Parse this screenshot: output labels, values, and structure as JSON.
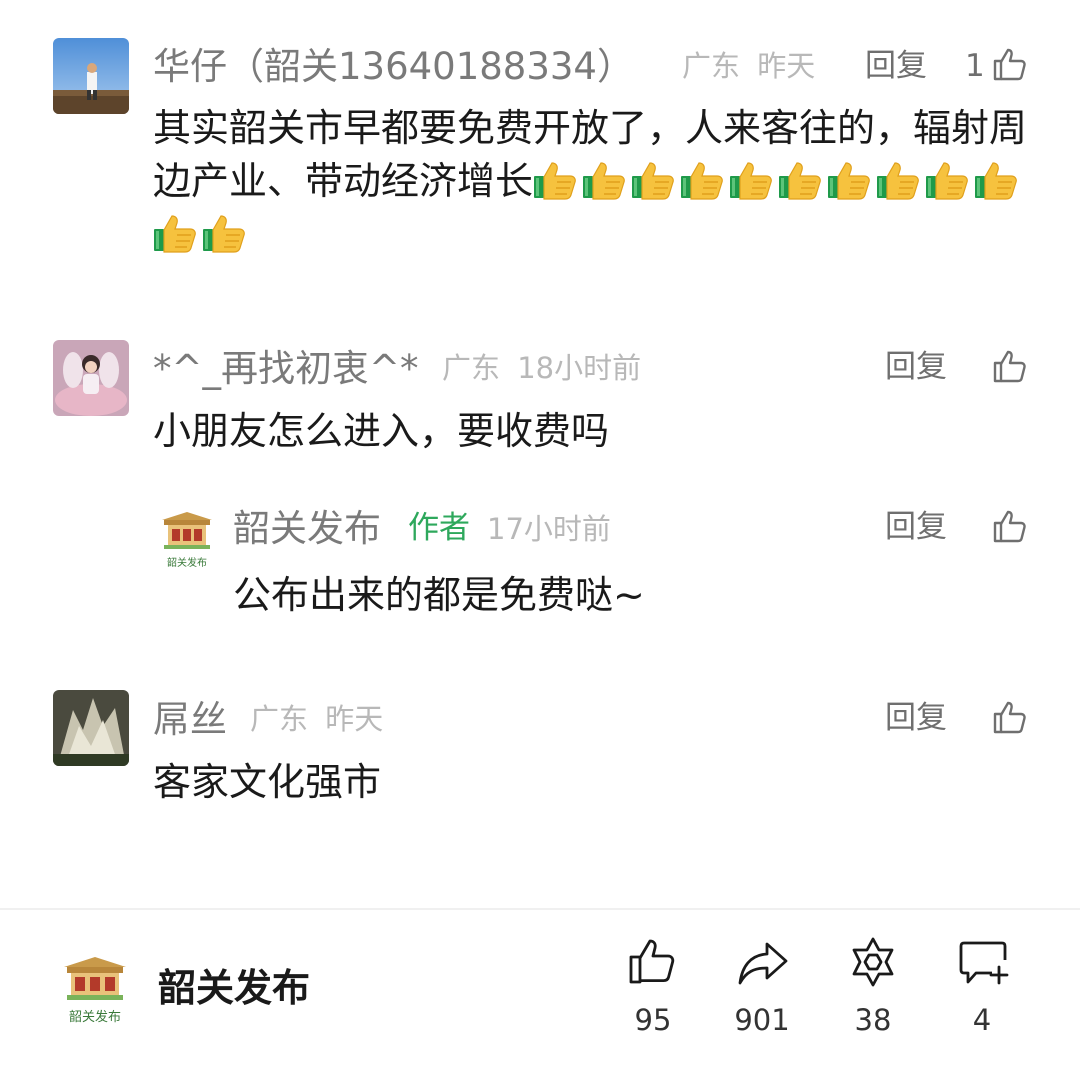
{
  "comments": [
    {
      "user": "华仔（韶关13640188334）",
      "location": "广东",
      "time": "昨天",
      "reply_label": "回复",
      "like_count": "1",
      "text": "其实韶关市早都要免费开放了，人来客往的，辐射周边产业、带动经济增长",
      "emoji_count": 12,
      "emoji": "thumbs-up-emoji"
    },
    {
      "user": "*^_再找初衷^*",
      "location": "广东",
      "time": "18小时前",
      "reply_label": "回复",
      "like_count": "",
      "text": "小朋友怎么进入，要收费吗",
      "replies": [
        {
          "user": "韶关发布",
          "badge": "作者",
          "time": "17小时前",
          "reply_label": "回复",
          "like_count": "",
          "text": "公布出来的都是免费哒~",
          "avatar_caption": "韶关发布"
        }
      ]
    },
    {
      "user": "屌丝",
      "location": "广东",
      "time": "昨天",
      "reply_label": "回复",
      "like_count": "",
      "text": "客家文化强市"
    }
  ],
  "bottom_bar": {
    "account_name": "韶关发布",
    "logo_caption": "韶关发布",
    "actions": [
      {
        "name": "like",
        "icon": "thumbs-up-icon",
        "count": "95"
      },
      {
        "name": "share",
        "icon": "share-arrow-icon",
        "count": "901"
      },
      {
        "name": "favorite",
        "icon": "star-of-david-icon",
        "count": "38"
      },
      {
        "name": "comment",
        "icon": "comment-add-icon",
        "count": "4"
      }
    ]
  },
  "colors": {
    "author_badge": "#2ea85c",
    "meta_text": "#b8b8b8",
    "username": "#7a7a7a"
  }
}
